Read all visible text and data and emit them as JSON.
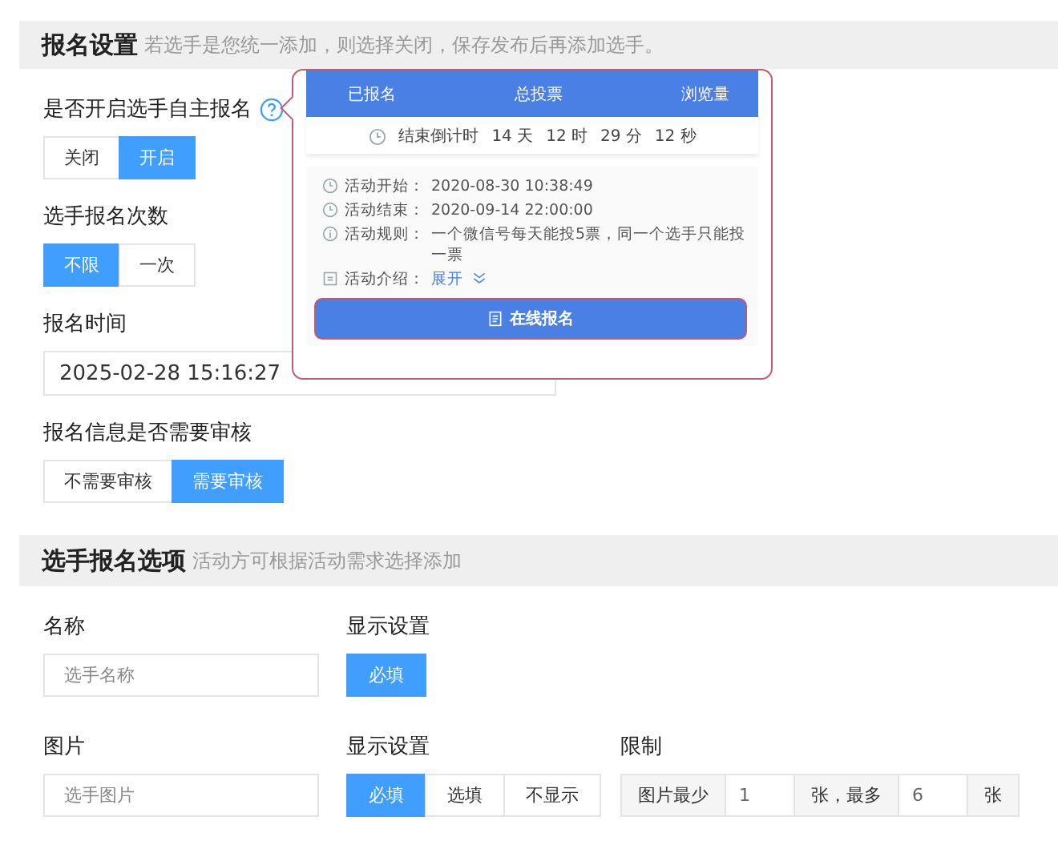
{
  "signup_section": {
    "title": "报名设置",
    "hint": "若选手是您统一添加，则选择关闭，保存发布后再添加选手。",
    "fields": [
      {
        "kind": "toggle",
        "label": "是否开启选手自主报名",
        "help": true,
        "options": [
          {
            "label": "关闭",
            "selected": false
          },
          {
            "label": "开启",
            "selected": true
          }
        ]
      },
      {
        "kind": "toggle",
        "label": "选手报名次数",
        "help": false,
        "options": [
          {
            "label": "不限",
            "selected": true
          },
          {
            "label": "一次",
            "selected": false
          }
        ]
      },
      {
        "kind": "daterange",
        "label": "报名时间",
        "start": "2025-02-28 15:16:27"
      },
      {
        "kind": "toggle",
        "label": "报名信息是否需要审核",
        "help": false,
        "options": [
          {
            "label": "不需要审核",
            "selected": false
          },
          {
            "label": "需要审核",
            "selected": true
          }
        ]
      }
    ]
  },
  "preview_popup": {
    "stats": [
      "已报名",
      "总投票",
      "浏览量"
    ],
    "countdown_label": "结束倒计时",
    "countdown": [
      "14 天",
      "12 时",
      "29 分",
      "12 秒"
    ],
    "info": [
      {
        "kind": "clock",
        "label": "活动开始：",
        "value": "2020-08-30   10:38:49"
      },
      {
        "kind": "clock",
        "label": "活动结束：",
        "value": "2020-09-14   22:00:00"
      },
      {
        "kind": "info",
        "label": "活动规则：",
        "value": "一个微信号每天能投5票，同一个选手只能投一票"
      },
      {
        "kind": "doc",
        "label": "活动介绍：",
        "link": "展开"
      }
    ],
    "button": "在线报名"
  },
  "options_section": {
    "title": "选手报名选项",
    "hint": "活动方可根据活动需求选择添加",
    "rows": [
      {
        "name_label": "名称",
        "placeholder": "选手名称",
        "display_label": "显示设置",
        "display": [
          {
            "label": "必填",
            "selected": true
          }
        ]
      },
      {
        "name_label": "图片",
        "placeholder": "选手图片",
        "display_label": "显示设置",
        "display": [
          {
            "label": "必填",
            "selected": true
          },
          {
            "label": "选填",
            "selected": false
          },
          {
            "label": "不显示",
            "selected": false
          }
        ],
        "limit": {
          "label": "限制",
          "parts": [
            {
              "kind": "text",
              "text": "图片最少"
            },
            {
              "kind": "value",
              "text": "1"
            },
            {
              "kind": "text",
              "text": "张，最多"
            },
            {
              "kind": "value",
              "text": "6"
            },
            {
              "kind": "text",
              "text": "张"
            }
          ]
        }
      }
    ]
  }
}
